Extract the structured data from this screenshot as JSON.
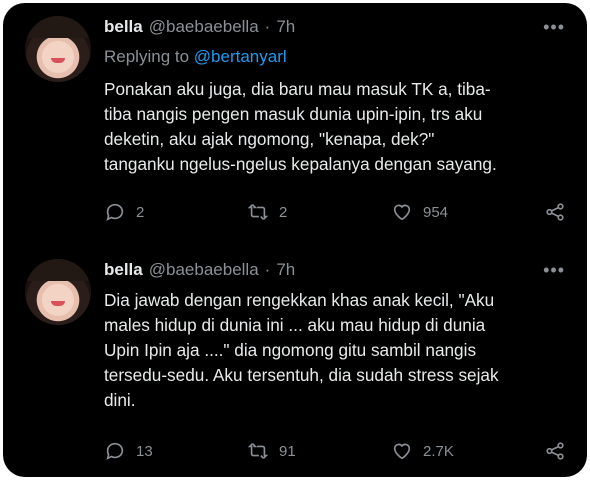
{
  "tweets": [
    {
      "name": "bella",
      "handle": "@baebaebella",
      "dot": "·",
      "time": "7h",
      "reply_prefix": "Replying to ",
      "reply_to": "@bertanyarl",
      "text": "Ponakan aku juga, dia baru mau masuk TK a, tiba-\ntiba nangis pengen masuk dunia upin-ipin, trs aku\ndeketin, aku ajak ngomong, \"kenapa, dek?\"\ntanganku ngelus-ngelus kepalanya dengan sayang.",
      "replies": "2",
      "retweets": "2",
      "likes": "954",
      "more": "•••",
      "icons": [
        "reply-icon",
        "retweet-icon",
        "like-icon",
        "share-icon"
      ]
    },
    {
      "name": "bella",
      "handle": "@baebaebella",
      "dot": "·",
      "time": "7h",
      "text": "Dia jawab dengan rengekkan khas anak kecil, \"Aku\nmales hidup di dunia ini ... aku mau hidup di dunia\nUpin Ipin aja ....\" dia ngomong gitu sambil nangis\ntersedu-sedu. Aku tersentuh, dia sudah stress sejak\ndini.",
      "replies": "13",
      "retweets": "91",
      "likes": "2.7K",
      "more": "•••",
      "icons": [
        "reply-icon",
        "retweet-icon",
        "like-icon",
        "share-icon"
      ]
    }
  ]
}
